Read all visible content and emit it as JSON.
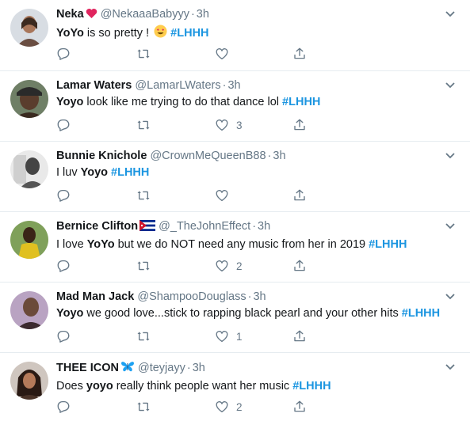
{
  "tweets": [
    {
      "name": "Neka",
      "name_emoji": "heart",
      "handle": "@NekaaaBabyyy",
      "time": "3h",
      "text": {
        "lead": "",
        "bold": "YoYo",
        "rest": " is so pretty ! ",
        "emoji": "heart-eyes",
        "tag": "#LHHH"
      },
      "likes": "",
      "colors": {
        "avatar_bg": "#d8dde3",
        "avatar_fg": "#6a4e42"
      }
    },
    {
      "name": "Lamar Waters",
      "name_emoji": "",
      "handle": "@LamarLWaters",
      "time": "3h",
      "text": {
        "lead": "",
        "bold": "Yoyo",
        "rest": " look like me trying to do that dance lol ",
        "emoji": "",
        "tag": "#LHHH"
      },
      "likes": "3",
      "colors": {
        "avatar_bg": "#6f7f66",
        "avatar_fg": "#3a2a20"
      }
    },
    {
      "name": "Bunnie Knichole",
      "name_emoji": "",
      "handle": "@CrownMeQueenB88",
      "time": "3h",
      "text": {
        "lead": "I luv ",
        "bold": "Yoyo",
        "rest": " ",
        "emoji": "",
        "tag": "#LHHH"
      },
      "likes": "",
      "colors": {
        "avatar_bg": "#e9e9e9",
        "avatar_fg": "#555555"
      }
    },
    {
      "name": "Bernice Clifton",
      "name_emoji": "flag-cuba",
      "handle": "@_TheJohnEffect",
      "time": "3h",
      "text": {
        "lead": "I love ",
        "bold": "YoYo",
        "rest": " but we do NOT need any music from her in 2019 ",
        "emoji": "",
        "tag": "#LHHH"
      },
      "likes": "2",
      "colors": {
        "avatar_bg": "#c9b24a",
        "avatar_fg": "#2d1f16"
      }
    },
    {
      "name": "Mad Man Jack",
      "name_emoji": "",
      "handle": "@ShampooDouglass",
      "time": "3h",
      "text": {
        "lead": "",
        "bold": "Yoyo",
        "rest": " we good love...stick to rapping black pearl and your other hits ",
        "emoji": "",
        "tag": "#LHHH"
      },
      "likes": "1",
      "colors": {
        "avatar_bg": "#b9a3c2",
        "avatar_fg": "#3b2a2e"
      }
    },
    {
      "name": "THEE ICON",
      "name_emoji": "butterfly",
      "handle": "@teyjayy",
      "time": "3h",
      "text": {
        "lead": "Does ",
        "bold": "yoyo",
        "rest": " really think people want her music ",
        "emoji": "",
        "tag": "#LHHH"
      },
      "likes": "2",
      "colors": {
        "avatar_bg": "#cfc6bf",
        "avatar_fg": "#4a3328"
      }
    }
  ],
  "separator": "·",
  "colors": {
    "text": "#14171a",
    "muted": "#657786",
    "link": "#1b95e0",
    "divider": "#e6ecf0"
  }
}
